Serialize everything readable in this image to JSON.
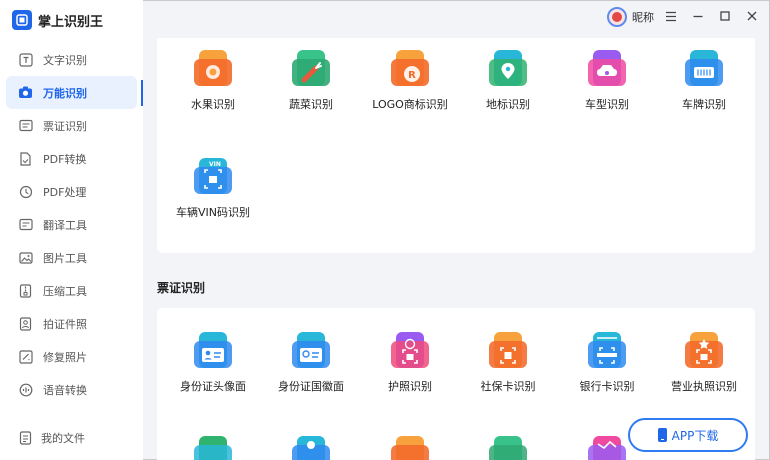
{
  "app": {
    "name": "掌上识别王"
  },
  "sidebar": {
    "items": [
      {
        "label": "文字识别",
        "icon": "text-recognition-icon"
      },
      {
        "label": "万能识别",
        "icon": "camera-icon",
        "active": true
      },
      {
        "label": "票证识别",
        "icon": "ticket-icon"
      },
      {
        "label": "PDF转换",
        "icon": "pdf-convert-icon"
      },
      {
        "label": "PDF处理",
        "icon": "pdf-process-icon"
      },
      {
        "label": "翻译工具",
        "icon": "translate-icon"
      },
      {
        "label": "图片工具",
        "icon": "image-icon"
      },
      {
        "label": "压缩工具",
        "icon": "compress-icon"
      },
      {
        "label": "拍证件照",
        "icon": "id-photo-icon"
      },
      {
        "label": "修复照片",
        "icon": "repair-photo-icon"
      },
      {
        "label": "语音转换",
        "icon": "voice-icon"
      }
    ],
    "my_files": "我的文件"
  },
  "titlebar": {
    "nickname": "昵称"
  },
  "universal": {
    "tiles": [
      {
        "label": "水果识别",
        "color_a": "#f7a23c",
        "color_b": "#f36a2a"
      },
      {
        "label": "蔬菜识别",
        "color_a": "#39c28a",
        "color_b": "#e85a3c"
      },
      {
        "label": "LOGO商标识别",
        "color_a": "#f7a23c",
        "color_b": "#f36a2a"
      },
      {
        "label": "地标识别",
        "color_a": "#28b7d8",
        "color_b": "#2fb36f"
      },
      {
        "label": "车型识别",
        "color_a": "#9a5cf0",
        "color_b": "#f04aa0"
      },
      {
        "label": "车牌识别",
        "color_a": "#28b7d8",
        "color_b": "#2f8af0"
      },
      {
        "label": "车辆VIN码识别",
        "color_a": "#28b7d8",
        "color_b": "#2f8af0"
      }
    ]
  },
  "tickets": {
    "title": "票证识别",
    "tiles": [
      {
        "label": "身份证头像面",
        "color_a": "#28b7d8",
        "color_b": "#2f8af0"
      },
      {
        "label": "身份证国徽面",
        "color_a": "#28b7d8",
        "color_b": "#2f8af0"
      },
      {
        "label": "护照识别",
        "color_a": "#9a5cf0",
        "color_b": "#f04a7a"
      },
      {
        "label": "社保卡识别",
        "color_a": "#f7a23c",
        "color_b": "#f36a2a"
      },
      {
        "label": "银行卡识别",
        "color_a": "#28b7d8",
        "color_b": "#2f8af0"
      },
      {
        "label": "营业执照识别",
        "color_a": "#f7a23c",
        "color_b": "#f36a2a"
      }
    ],
    "more_row_colors": [
      "#2fb36f",
      "#2f8af0",
      "#f7a23c",
      "#39c28a",
      "#f04aa0",
      "#28b7d8"
    ]
  },
  "app_download": {
    "label": "APP下载"
  }
}
